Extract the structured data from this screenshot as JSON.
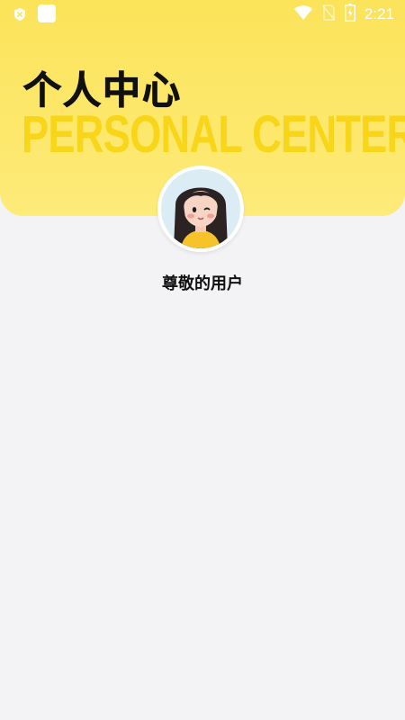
{
  "status_bar": {
    "time": "2:21",
    "icons": [
      "shield-icon",
      "app-icon",
      "wifi-icon",
      "sim-icon",
      "battery-icon"
    ]
  },
  "header": {
    "title": "个人中心",
    "subtitle": "PERSONAL CENTER"
  },
  "profile": {
    "username": "尊敬的用户",
    "avatar_icon": "avatar-icon"
  },
  "colors": {
    "header_yellow": "#fbe35a",
    "subtitle_yellow": "#f8d410",
    "page_background": "#f3f2f4"
  }
}
